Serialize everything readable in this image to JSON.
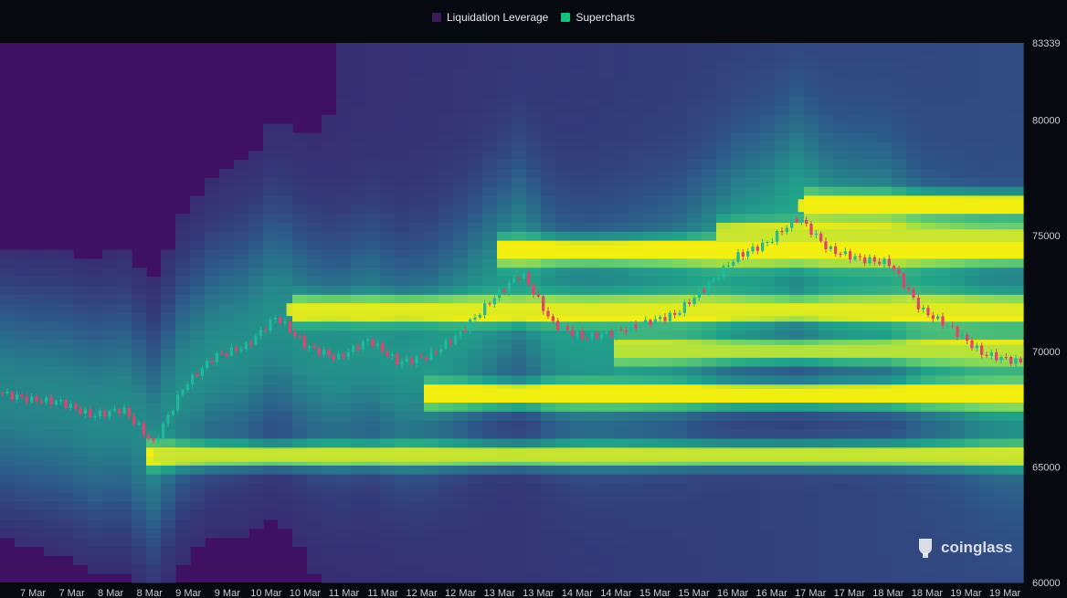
{
  "legend": {
    "items": [
      {
        "label": "Liquidation Leverage",
        "color": "#3a1a5c"
      },
      {
        "label": "Supercharts",
        "color": "#17c27a"
      }
    ]
  },
  "watermark": {
    "text": "coinglass",
    "icon": "coinglass-logo-icon"
  },
  "chart_data": {
    "type": "heatmap",
    "x_tick_labels": [
      "7 Mar",
      "7 Mar",
      "8 Mar",
      "8 Mar",
      "9 Mar",
      "9 Mar",
      "10 Mar",
      "10 Mar",
      "11 Mar",
      "11 Mar",
      "12 Mar",
      "12 Mar",
      "13 Mar",
      "13 Mar",
      "14 Mar",
      "14 Mar",
      "15 Mar",
      "15 Mar",
      "16 Mar",
      "16 Mar",
      "17 Mar",
      "17 Mar",
      "18 Mar",
      "18 Mar",
      "19 Mar",
      "19 Mar"
    ],
    "y_tick_labels": [
      "83339",
      "80000",
      "75000",
      "70000",
      "65000",
      "60000"
    ],
    "ylim": [
      60000,
      83339
    ],
    "colorscale": [
      "#3e1162",
      "#2d5a8a",
      "#20a38a",
      "#6ed36a",
      "#f2ee12"
    ],
    "candle_colors": {
      "up": "#1fb89a",
      "down": "#e0436b"
    },
    "price_path": [
      [
        0,
        68200
      ],
      [
        0.03,
        67900
      ],
      [
        0.06,
        67800
      ],
      [
        0.09,
        67200
      ],
      [
        0.12,
        67500
      ],
      [
        0.15,
        66000
      ],
      [
        0.18,
        68500
      ],
      [
        0.21,
        69800
      ],
      [
        0.24,
        70200
      ],
      [
        0.27,
        71500
      ],
      [
        0.3,
        70200
      ],
      [
        0.33,
        69700
      ],
      [
        0.36,
        70500
      ],
      [
        0.39,
        69500
      ],
      [
        0.42,
        69800
      ],
      [
        0.45,
        70800
      ],
      [
        0.48,
        72200
      ],
      [
        0.51,
        73400
      ],
      [
        0.54,
        71200
      ],
      [
        0.57,
        70600
      ],
      [
        0.6,
        70800
      ],
      [
        0.63,
        71200
      ],
      [
        0.66,
        71600
      ],
      [
        0.69,
        72800
      ],
      [
        0.72,
        74100
      ],
      [
        0.75,
        74700
      ],
      [
        0.78,
        75800
      ],
      [
        0.81,
        74400
      ],
      [
        0.84,
        74000
      ],
      [
        0.87,
        73800
      ],
      [
        0.9,
        71800
      ],
      [
        0.93,
        71000
      ],
      [
        0.96,
        69900
      ],
      [
        1.0,
        69500
      ]
    ],
    "liquidation_bands": [
      {
        "price": 76300,
        "start": 0.78,
        "intensity": 1.0
      },
      {
        "price": 74300,
        "start": 0.49,
        "intensity": 1.0
      },
      {
        "price": 71800,
        "start": 0.28,
        "intensity": 0.9
      },
      {
        "price": 68100,
        "start": 0.42,
        "intensity": 1.0
      },
      {
        "price": 65500,
        "start": 0.15,
        "intensity": 0.8
      },
      {
        "price": 70000,
        "start": 0.6,
        "intensity": 0.7
      },
      {
        "price": 75000,
        "start": 0.7,
        "intensity": 0.8
      }
    ]
  }
}
